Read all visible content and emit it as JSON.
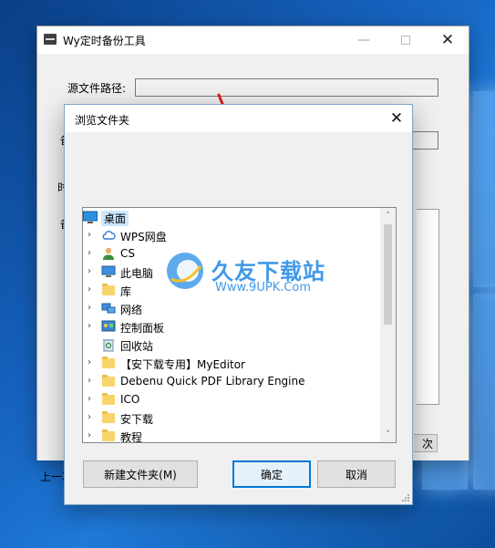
{
  "main_window": {
    "title": "Wy定时备份工具",
    "source_label": "源文件路径:",
    "label2_fragment": "备",
    "label3_fragment": "时",
    "label4_fragment": "备",
    "bottom_fragment": "上一次",
    "edge_button_fragment": "次"
  },
  "dialog": {
    "title": "浏览文件夹",
    "tree": {
      "root": "桌面",
      "items": [
        {
          "label": "WPS网盘",
          "icon": "cloud-icon",
          "expandable": true
        },
        {
          "label": "CS",
          "icon": "user-icon",
          "expandable": true
        },
        {
          "label": "此电脑",
          "icon": "computer-icon",
          "expandable": true
        },
        {
          "label": "库",
          "icon": "folder-icon",
          "expandable": true
        },
        {
          "label": "网络",
          "icon": "network-icon",
          "expandable": true
        },
        {
          "label": "控制面板",
          "icon": "control-panel-icon",
          "expandable": true
        },
        {
          "label": "回收站",
          "icon": "recycle-bin-icon",
          "expandable": false
        },
        {
          "label": "【安下载专用】MyEditor",
          "icon": "folder-icon",
          "expandable": true
        },
        {
          "label": "Debenu Quick PDF Library Engine",
          "icon": "folder-icon",
          "expandable": true
        },
        {
          "label": "ICO",
          "icon": "folder-icon",
          "expandable": true
        },
        {
          "label": "安下载",
          "icon": "folder-icon",
          "expandable": true
        },
        {
          "label": "教程",
          "icon": "folder-icon",
          "expandable": true
        }
      ]
    },
    "new_folder_button": "新建文件夹(M)",
    "ok_button": "确定",
    "cancel_button": "取消"
  },
  "watermark": {
    "title": "久友下载站",
    "url": "Www.9UPK.Com",
    "overlay_fragment": "此电脑 9UPK.com"
  },
  "colors": {
    "accent": "#0078d7",
    "selection": "#cce8ff",
    "annotation_arrow": "#e0201b"
  }
}
